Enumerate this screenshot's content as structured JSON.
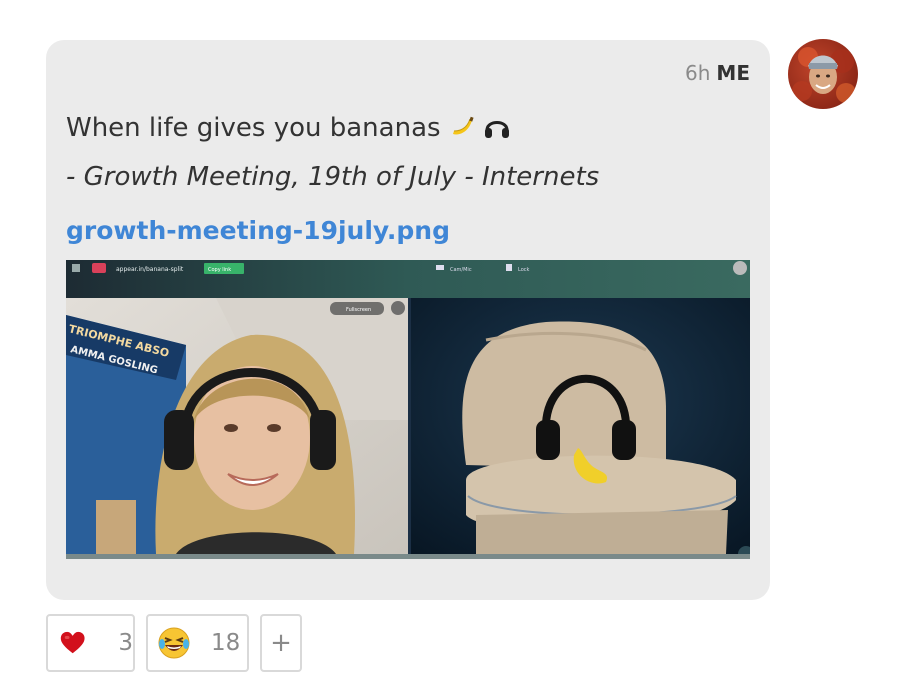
{
  "message": {
    "time": "6h",
    "author": "ME",
    "text": "When life gives you bananas",
    "text_emojis": [
      "banana-icon",
      "headphones-icon"
    ],
    "quote": "- Growth Meeting, 19th of July - Internets",
    "attachment": {
      "filename": "growth-meeting-19july.png",
      "preview": {
        "url": "appear.in/banana-split",
        "copy_link": "Copy link",
        "cam_mic": "Cam/Mic",
        "lock": "Lock",
        "fullscreen": "Fullscreen",
        "poster_text_1": "TRIOMPHE ABSO",
        "poster_text_2": "AMMA GOSLING"
      }
    }
  },
  "reactions": [
    {
      "icon": "heart-icon",
      "count": "3"
    },
    {
      "icon": "laughing-emoji-icon",
      "count": "18"
    }
  ],
  "add_reaction": "+",
  "colors": {
    "bubble": "#ebebeb",
    "link": "#3f86d6",
    "author": "#333333",
    "time": "#8a8a8a"
  }
}
